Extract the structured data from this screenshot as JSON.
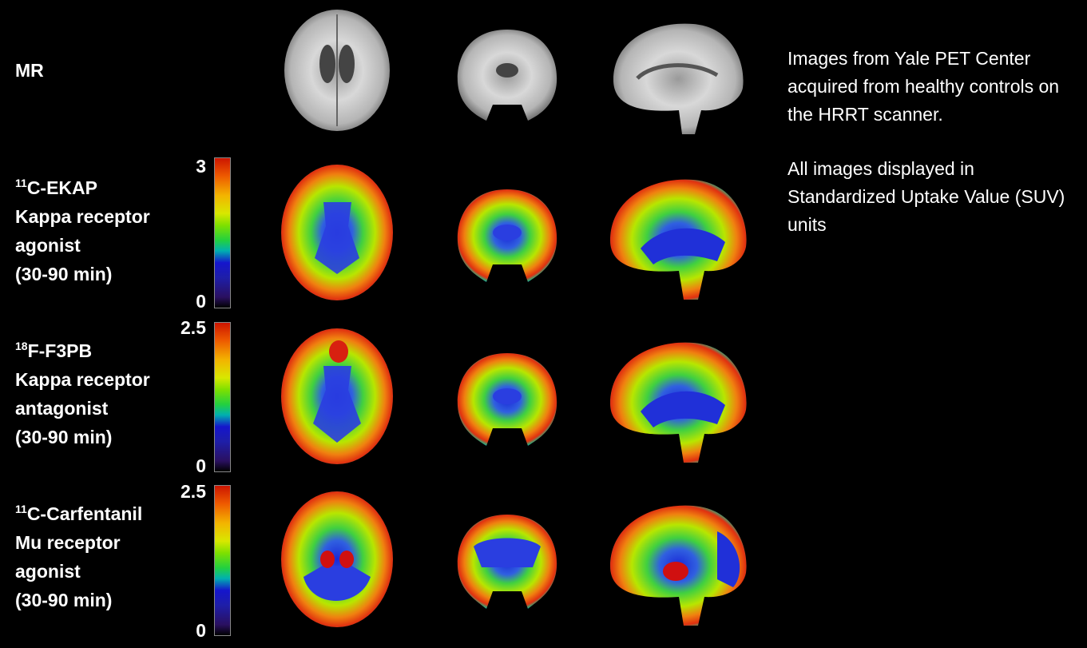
{
  "colors": {
    "background": "#000000",
    "text": "#ffffff"
  },
  "rows": [
    {
      "id": "mr",
      "label_lines": [
        "MR"
      ],
      "kind": "mr"
    },
    {
      "id": "ekap",
      "superscript": "11",
      "label_lines": [
        "C-EKAP",
        "Kappa receptor",
        "agonist",
        "(30-90 min)"
      ],
      "scale_max": "3",
      "scale_min": "0",
      "kind": "pet"
    },
    {
      "id": "f3pb",
      "superscript": "18",
      "label_lines": [
        "F-F3PB",
        "Kappa receptor",
        "antagonist",
        "(30-90 min)"
      ],
      "scale_max": "2.5",
      "scale_min": "0",
      "kind": "pet"
    },
    {
      "id": "carfentanil",
      "superscript": "11",
      "label_lines": [
        "C-Carfentanil",
        "Mu receptor",
        "agonist",
        "(30-90 min)"
      ],
      "scale_max": "2.5",
      "scale_min": "0",
      "kind": "pet"
    }
  ],
  "views": [
    "axial",
    "coronal",
    "sagittal"
  ],
  "info": {
    "paragraph1": "Images from Yale PET Center acquired from healthy controls on the HRRT scanner.",
    "paragraph2": "All images displayed in Standardized Uptake Value (SUV) units"
  }
}
